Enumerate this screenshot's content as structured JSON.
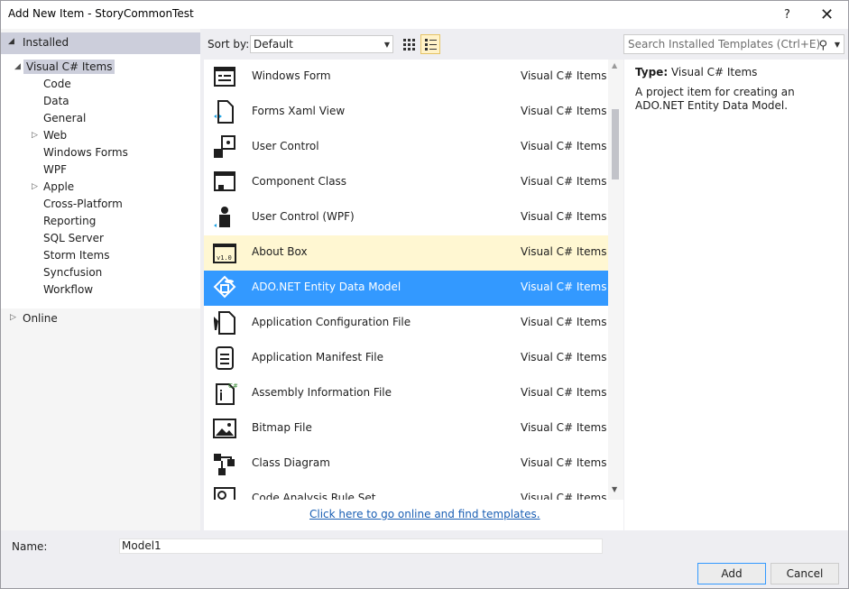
{
  "window": {
    "title": "Add New Item - StoryCommonTest",
    "help": "?",
    "close": "✕"
  },
  "left": {
    "installed": "Installed",
    "root": "Visual C# Items",
    "children": [
      {
        "label": "Code",
        "expandable": false
      },
      {
        "label": "Data",
        "expandable": false
      },
      {
        "label": "General",
        "expandable": false
      },
      {
        "label": "Web",
        "expandable": true
      },
      {
        "label": "Windows Forms",
        "expandable": false
      },
      {
        "label": "WPF",
        "expandable": false
      },
      {
        "label": "Apple",
        "expandable": true
      },
      {
        "label": "Cross-Platform",
        "expandable": false
      },
      {
        "label": "Reporting",
        "expandable": false
      },
      {
        "label": "SQL Server",
        "expandable": false
      },
      {
        "label": "Storm Items",
        "expandable": false
      },
      {
        "label": "Syncfusion",
        "expandable": false
      },
      {
        "label": "Workflow",
        "expandable": false
      }
    ],
    "online": "Online"
  },
  "toolbar": {
    "sort_label": "Sort by:",
    "sort_value": "Default"
  },
  "search": {
    "placeholder": "Search Installed Templates (Ctrl+E)"
  },
  "templates": [
    {
      "name": "Windows Form",
      "category": "Visual C# Items",
      "icon": "form-icon",
      "state": ""
    },
    {
      "name": "Forms Xaml View",
      "category": "Visual C# Items",
      "icon": "xaml-file-icon",
      "state": ""
    },
    {
      "name": "User Control",
      "category": "Visual C# Items",
      "icon": "user-control-icon",
      "state": ""
    },
    {
      "name": "Component Class",
      "category": "Visual C# Items",
      "icon": "component-icon",
      "state": ""
    },
    {
      "name": "User Control (WPF)",
      "category": "Visual C# Items",
      "icon": "user-control-wpf-icon",
      "state": ""
    },
    {
      "name": "About Box",
      "category": "Visual C# Items",
      "icon": "about-box-icon",
      "state": "hover"
    },
    {
      "name": "ADO.NET Entity Data Model",
      "category": "Visual C# Items",
      "icon": "entity-model-icon",
      "state": "selected"
    },
    {
      "name": "Application Configuration File",
      "category": "Visual C# Items",
      "icon": "config-file-icon",
      "state": ""
    },
    {
      "name": "Application Manifest File",
      "category": "Visual C# Items",
      "icon": "manifest-icon",
      "state": ""
    },
    {
      "name": "Assembly Information File",
      "category": "Visual C# Items",
      "icon": "assembly-info-icon",
      "state": ""
    },
    {
      "name": "Bitmap File",
      "category": "Visual C# Items",
      "icon": "bitmap-icon",
      "state": ""
    },
    {
      "name": "Class Diagram",
      "category": "Visual C# Items",
      "icon": "class-diagram-icon",
      "state": ""
    },
    {
      "name": "Code Analysis Rule Set",
      "category": "Visual C# Items",
      "icon": "rule-set-icon",
      "state": ""
    }
  ],
  "online_link": "Click here to go online and find templates.",
  "description": {
    "type_label": "Type:",
    "type_value": "Visual C# Items",
    "text": "A project item for creating an ADO.NET Entity Data Model."
  },
  "bottom": {
    "name_label": "Name:",
    "name_value": "Model1",
    "add": "Add",
    "cancel": "Cancel"
  }
}
